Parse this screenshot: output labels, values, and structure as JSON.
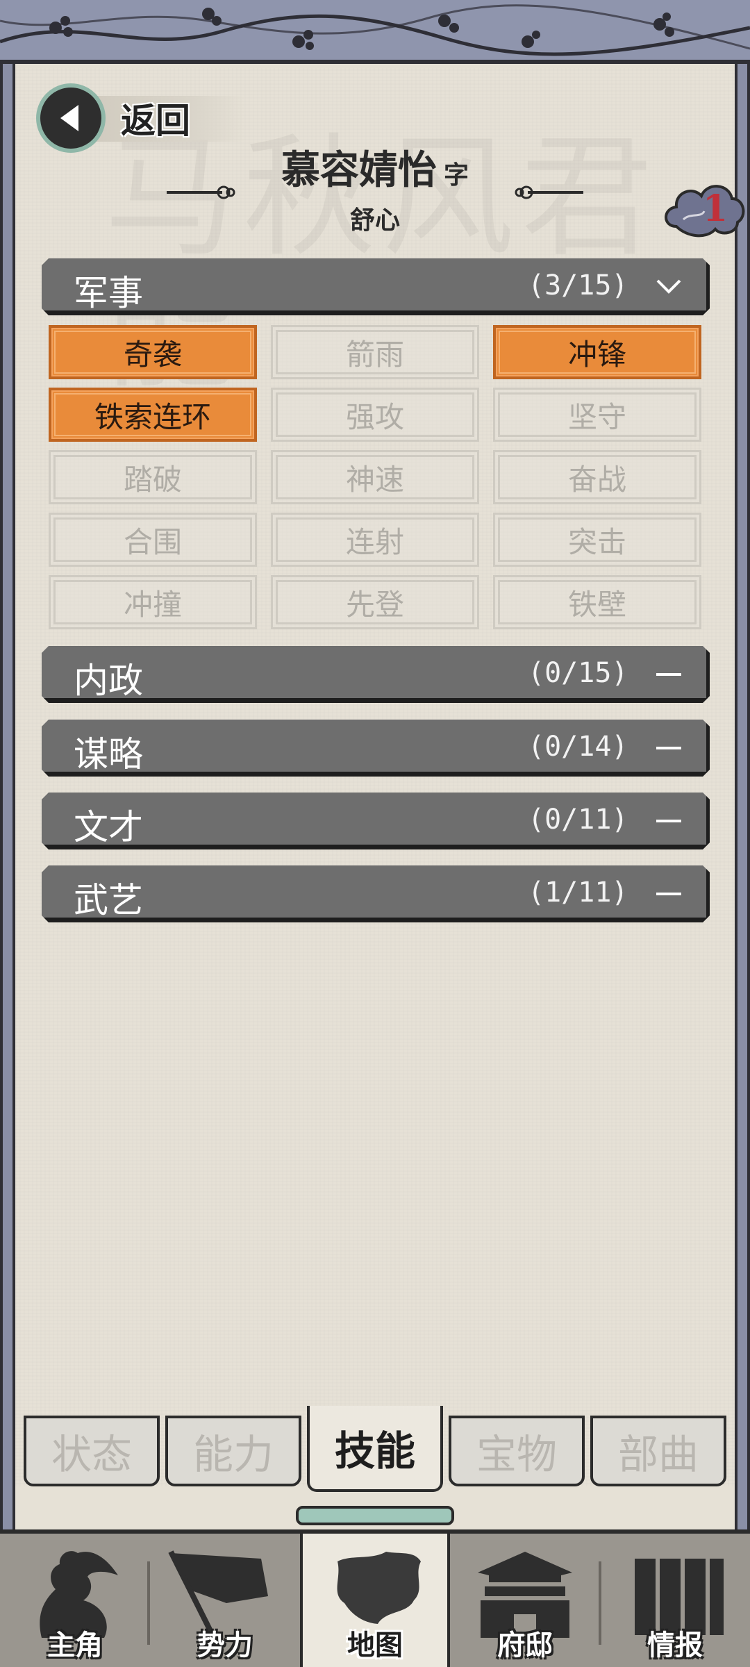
{
  "header": {
    "back_label": "返回",
    "name": "慕容婧怡",
    "zi_label": "字",
    "courtesy_name": "舒心",
    "badge_count": "1"
  },
  "watermark_text": "马秋风君能",
  "categories": [
    {
      "title": "军事",
      "count": "(3/15)",
      "expanded": true,
      "skills": [
        {
          "label": "奇袭",
          "active": true
        },
        {
          "label": "箭雨",
          "active": false
        },
        {
          "label": "冲锋",
          "active": true
        },
        {
          "label": "铁索连环",
          "active": true
        },
        {
          "label": "强攻",
          "active": false
        },
        {
          "label": "坚守",
          "active": false
        },
        {
          "label": "踏破",
          "active": false
        },
        {
          "label": "神速",
          "active": false
        },
        {
          "label": "奋战",
          "active": false
        },
        {
          "label": "合围",
          "active": false
        },
        {
          "label": "连射",
          "active": false
        },
        {
          "label": "突击",
          "active": false
        },
        {
          "label": "冲撞",
          "active": false
        },
        {
          "label": "先登",
          "active": false
        },
        {
          "label": "铁壁",
          "active": false
        }
      ]
    },
    {
      "title": "内政",
      "count": "(0/15)",
      "expanded": false
    },
    {
      "title": "谋略",
      "count": "(0/14)",
      "expanded": false
    },
    {
      "title": "文才",
      "count": "(0/11)",
      "expanded": false
    },
    {
      "title": "武艺",
      "count": "(1/11)",
      "expanded": false
    }
  ],
  "sub_tabs": [
    {
      "label": "状态",
      "active": false
    },
    {
      "label": "能力",
      "active": false
    },
    {
      "label": "技能",
      "active": true
    },
    {
      "label": "宝物",
      "active": false
    },
    {
      "label": "部曲",
      "active": false
    }
  ],
  "bottom_nav": [
    {
      "label": "主角",
      "icon": "warrior-icon",
      "active": false
    },
    {
      "label": "势力",
      "icon": "flag-icon",
      "active": false
    },
    {
      "label": "地图",
      "icon": "map-icon",
      "active": true
    },
    {
      "label": "府邸",
      "icon": "mansion-icon",
      "active": false
    },
    {
      "label": "情报",
      "icon": "scroll-icon",
      "active": false
    }
  ],
  "colors": {
    "skill_active": "#e98b3a",
    "header_bar": "#6e6e6e",
    "frame": "#8f95ad",
    "badge_number": "#c0303a"
  }
}
